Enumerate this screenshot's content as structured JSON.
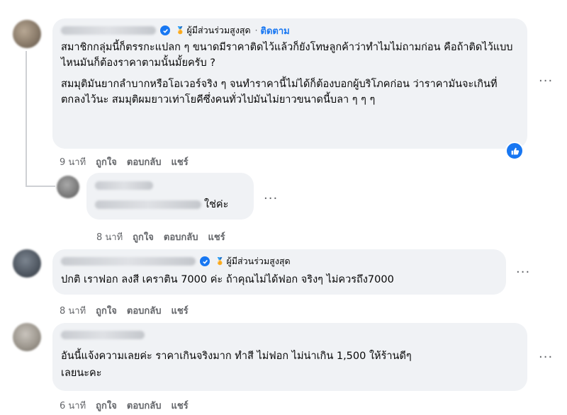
{
  "comments": [
    {
      "badge": "ผู้มีส่วนร่วมสูงสุด",
      "separator": "·",
      "follow": "ติดตาม",
      "paragraphs": [
        "สมาชิกกลุ่มนี้ก็ตรรกะแปลก ๆ ขนาดมีราคาติดไว้แล้วก็ยังโทษลูกค้าว่าทำไมไม่ถามก่อน คือถ้าติดไว้แบบไหนมันก็ต้องราคาตามนั้นมั้ยครับ ?",
        "สมมุติมันยากลำบากหรือโอเวอร์จริง ๆ จนทำราคานี้ไม่ได้ก็ต้องบอกผู้บริโภคก่อน ว่าราคามันจะเกินที่ตกลงไว้นะ สมมุติผมยาวเท่าโยคีซึ่งคนทั่วไปมันไม่ยาวขนาดนี้บลา ๆ ๆ ๆ"
      ],
      "time": "9 นาที",
      "like": "ถูกใจ",
      "reply": "ตอบกลับ",
      "share": "แชร์",
      "reaction_icon": "like-icon"
    },
    {
      "text": "ใช่ค่ะ",
      "time": "8 นาที",
      "like": "ถูกใจ",
      "reply": "ตอบกลับ",
      "share": "แชร์"
    },
    {
      "badge": "ผู้มีส่วนร่วมสูงสุด",
      "text": "ปกติ เราฟอก ลงสี เคราติน 7000 ค่ะ ถ้าคุณไม่ได้ฟอก จริงๆ ไม่ควรถึง7000",
      "time": "8 นาที",
      "like": "ถูกใจ",
      "reply": "ตอบกลับ",
      "share": "แชร์"
    },
    {
      "lines": [
        "อันนี้แจ้งความเลยค่ะ ราคาเกินจริงมาก ทำสี ไม่ฟอก ไม่น่าเกิน 1,500 ให้ร้านดีๆ",
        "เลยนะคะ"
      ],
      "time": "6 นาที",
      "like": "ถูกใจ",
      "reply": "ตอบกลับ",
      "share": "แชร์"
    }
  ],
  "more_glyph": "···",
  "colors": {
    "accent": "#1877f2",
    "bubble": "#f0f2f5",
    "meta": "#65676b"
  }
}
